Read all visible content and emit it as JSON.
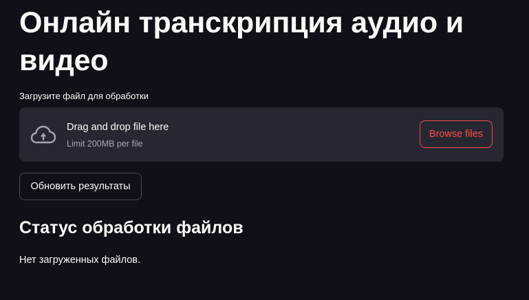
{
  "header": {
    "title": "Онлайн транскрипция аудио и видео"
  },
  "uploader": {
    "label": "Загрузите файл для обработки",
    "dropzone_title": "Drag and drop file here",
    "dropzone_limit": "Limit 200MB per file",
    "browse_label": "Browse files",
    "icon": "cloud-upload-icon"
  },
  "actions": {
    "refresh_label": "Обновить результаты"
  },
  "status": {
    "heading": "Статус обработки файлов",
    "message": "Нет загруженных файлов."
  },
  "colors": {
    "background": "#0e1117",
    "surface": "#262730",
    "accent": "#ff4b4b",
    "text": "#fafafa",
    "muted_text": "#a3a8b8"
  }
}
